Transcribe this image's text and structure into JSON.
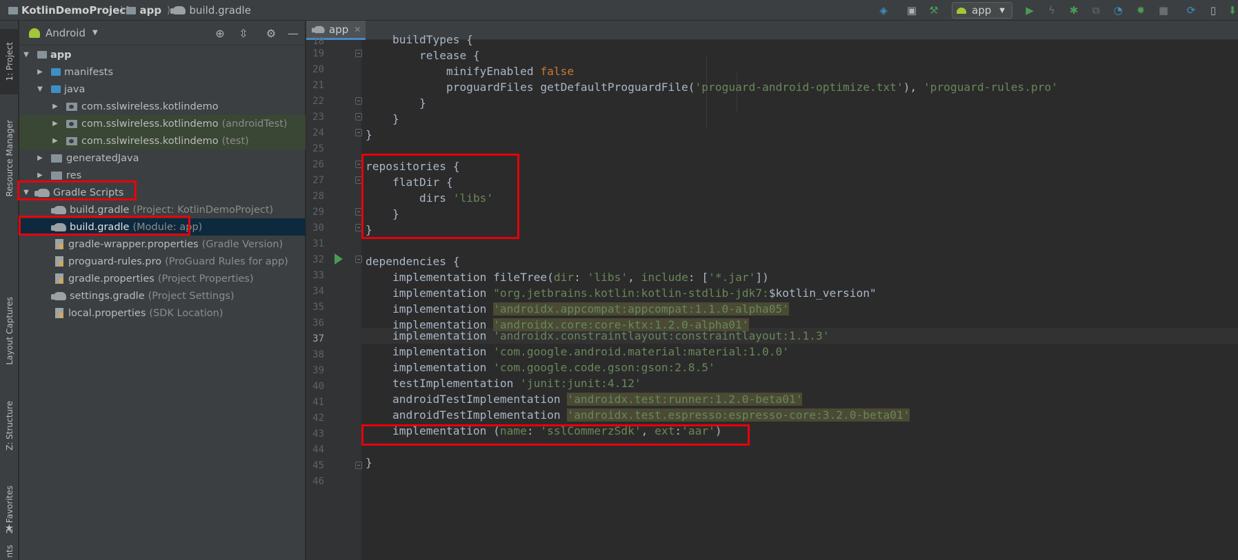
{
  "breadcrumb": {
    "project": "KotlinDemoProject",
    "module": "app",
    "file": "build.gradle"
  },
  "toolbar": {
    "run_config": "app"
  },
  "left_strip": {
    "tabs": [
      "1: Project",
      "Resource Manager",
      "Layout Captures",
      "Z: Structure",
      "2: Favorites",
      "nts"
    ]
  },
  "project_panel": {
    "view": "Android",
    "tree": [
      {
        "label": "app",
        "hint": ""
      },
      {
        "label": "manifests",
        "hint": ""
      },
      {
        "label": "java",
        "hint": ""
      },
      {
        "label": "com.sslwireless.kotlindemo",
        "hint": ""
      },
      {
        "label": "com.sslwireless.kotlindemo",
        "hint": "(androidTest)"
      },
      {
        "label": "com.sslwireless.kotlindemo",
        "hint": "(test)"
      },
      {
        "label": "generatedJava",
        "hint": ""
      },
      {
        "label": "res",
        "hint": ""
      },
      {
        "label": "Gradle Scripts",
        "hint": ""
      },
      {
        "label": "build.gradle",
        "hint": "(Project: KotlinDemoProject)"
      },
      {
        "label": "build.gradle",
        "hint": "(Module: app)"
      },
      {
        "label": "gradle-wrapper.properties",
        "hint": "(Gradle Version)"
      },
      {
        "label": "proguard-rules.pro",
        "hint": "(ProGuard Rules for app)"
      },
      {
        "label": "gradle.properties",
        "hint": "(Project Properties)"
      },
      {
        "label": "settings.gradle",
        "hint": "(Project Settings)"
      },
      {
        "label": "local.properties",
        "hint": "(SDK Location)"
      }
    ]
  },
  "editor": {
    "tab": "app",
    "line_numbers": [
      "18",
      "19",
      "20",
      "21",
      "22",
      "23",
      "24",
      "25",
      "26",
      "27",
      "28",
      "29",
      "30",
      "31",
      "32",
      "33",
      "34",
      "35",
      "36",
      "37",
      "38",
      "39",
      "40",
      "41",
      "42",
      "43",
      "44",
      "45",
      "46"
    ],
    "code": {
      "l18": "    buildTypes {",
      "l19a": "        release {",
      "l20a": "            minifyEnabled ",
      "l20b": "false",
      "l21a": "            proguardFiles getDefaultProguardFile(",
      "l21b": "'proguard-android-optimize.txt'",
      "l21c": "), ",
      "l21d": "'proguard-rules.pro'",
      "l22": "        }",
      "l23": "    }",
      "l24": "}",
      "l26": "repositories {",
      "l27": "    flatDir {",
      "l28a": "        dirs ",
      "l28b": "'libs'",
      "l29": "    }",
      "l30": "}",
      "l32": "dependencies {",
      "l33a": "    implementation fileTree(",
      "l33b": "dir",
      "l33c": ": ",
      "l33d": "'libs'",
      "l33e": ", ",
      "l33f": "include",
      "l33g": ": [",
      "l33h": "'*.jar'",
      "l33i": "])",
      "l34a": "    implementation ",
      "l34b": "\"org.jetbrains.kotlin:kotlin-stdlib-jdk7:",
      "l34c": "$kotlin_version\"",
      "l35a": "    implementation ",
      "l35b": "'androidx.appcompat:appcompat:1.1.0-alpha05'",
      "l36a": "    implementation ",
      "l36b": "'androidx.core:core-ktx:1.2.0-alpha01'",
      "l37a": "    implementation ",
      "l37b": "'androidx.constraintlayout:constraintlayout:1.1.3'",
      "l38a": "    implementation ",
      "l38b": "'com.google.android.material:material:1.0.0'",
      "l39a": "    implementation ",
      "l39b": "'com.google.code.gson:gson:2.8.5'",
      "l40a": "    testImplementation ",
      "l40b": "'junit:junit:4.12'",
      "l41a": "    androidTestImplementation ",
      "l41b": "'androidx.test:runner:1.2.0-beta01'",
      "l42a": "    androidTestImplementation ",
      "l42b": "'androidx.test.espresso:espresso-core:3.2.0-beta01'",
      "l43a": "    implementation (",
      "l43b": "name",
      "l43c": ": ",
      "l43d": "'sslCommerzSdk'",
      "l43e": ", ",
      "l43f": "ext",
      "l43g": ":",
      "l43h": "'aar'",
      "l43i": ")",
      "l45": "}"
    }
  },
  "colors": {
    "highlight_box": "#e8000b",
    "string": "#6a8759",
    "keyword": "#cc7832",
    "selection": "#0d293e"
  }
}
